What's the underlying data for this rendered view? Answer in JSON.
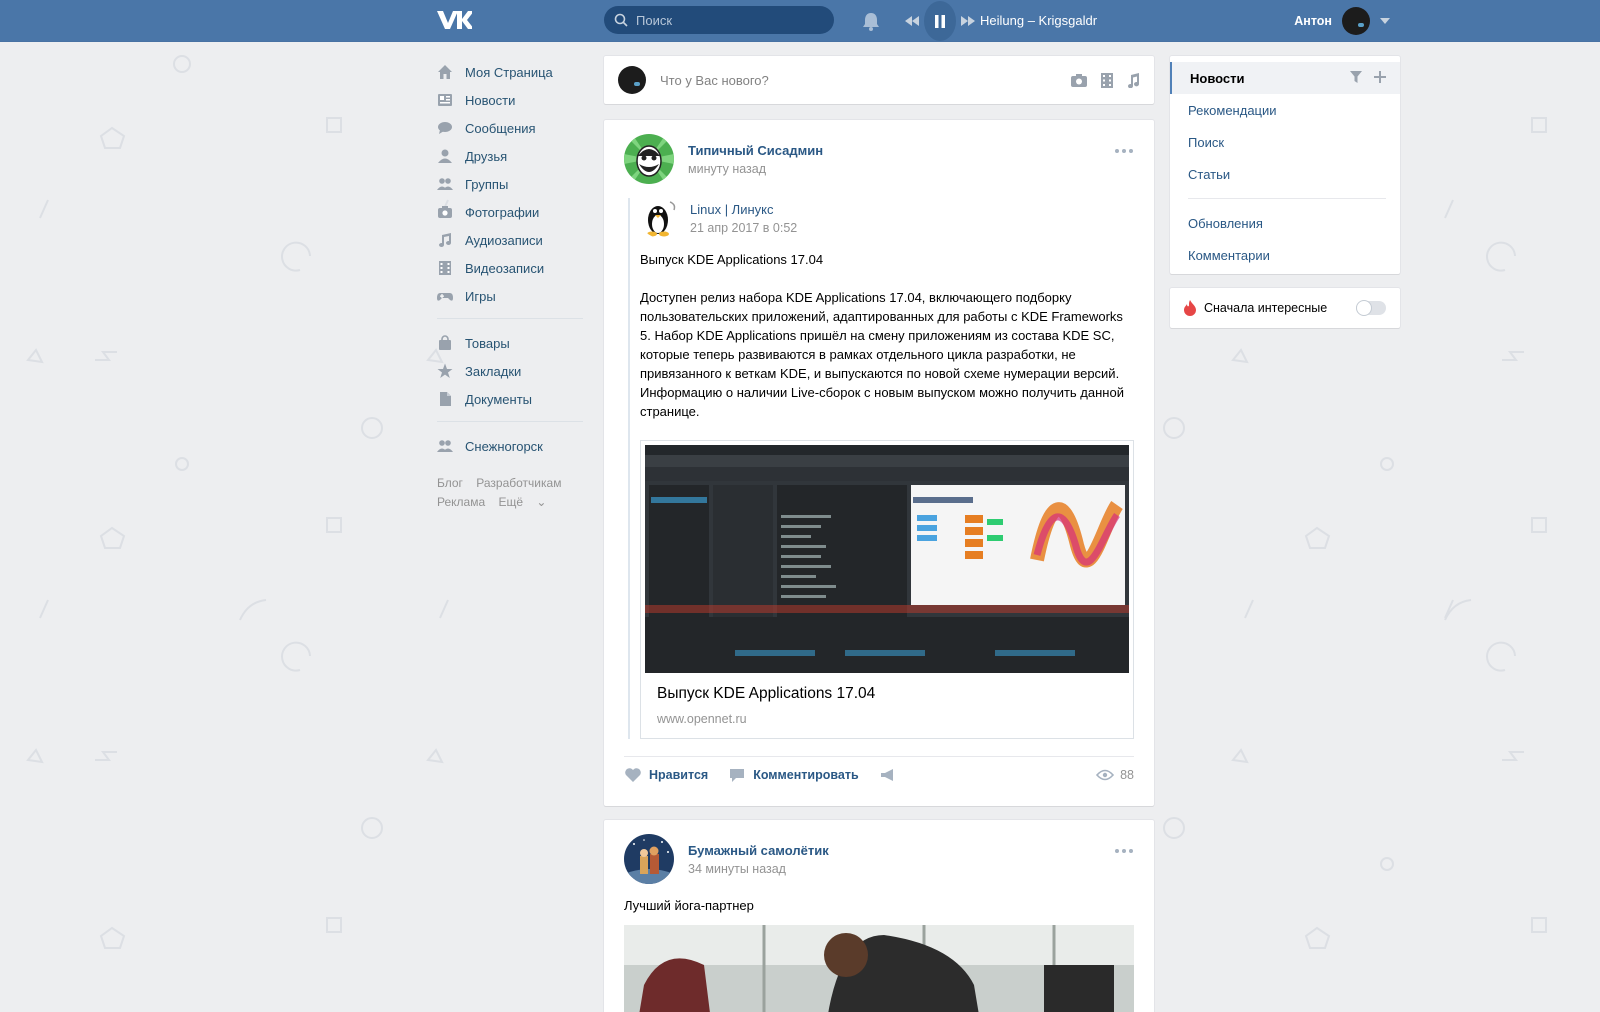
{
  "header": {
    "search_placeholder": "Поиск",
    "track": "Heilung – Krigsgaldr",
    "user_name": "Антон"
  },
  "composer": {
    "placeholder": "Что у Вас нового?"
  },
  "left_nav": {
    "main": [
      {
        "label": "Моя Страница",
        "icon": "home-icon"
      },
      {
        "label": "Новости",
        "icon": "news-icon"
      },
      {
        "label": "Сообщения",
        "icon": "messages-icon"
      },
      {
        "label": "Друзья",
        "icon": "friends-icon"
      },
      {
        "label": "Группы",
        "icon": "groups-icon"
      },
      {
        "label": "Фотографии",
        "icon": "camera-icon"
      },
      {
        "label": "Аудиозаписи",
        "icon": "music-icon"
      },
      {
        "label": "Видеозаписи",
        "icon": "film-icon"
      },
      {
        "label": "Игры",
        "icon": "gamepad-icon"
      }
    ],
    "secondary": [
      {
        "label": "Товары",
        "icon": "bag-icon"
      },
      {
        "label": "Закладки",
        "icon": "star-icon"
      },
      {
        "label": "Документы",
        "icon": "document-icon"
      }
    ],
    "communities": [
      {
        "label": "Снежногорск",
        "icon": "group-icon"
      }
    ],
    "footer": {
      "blog": "Блог",
      "developers": "Разработчикам",
      "ads": "Реклама",
      "more": "Ещё"
    }
  },
  "post1": {
    "author": "Типичный Сисадмин",
    "time": "минуту назад",
    "repost": {
      "author": "Linux | Линукс",
      "time": "21 апр 2017 в 0:52"
    },
    "text_title": "Выпуск KDE Applications 17.04",
    "text_body": "Доступен релиз набора KDE Applications 17.04, включающего подборку пользовательских приложений, адаптированных для работы с KDE Frameworks 5. Набор KDE Applications пришёл на смену приложениям из состава KDE SC, которые теперь развиваются в рамках отдельного цикла разработки, не привязанного к веткам KDE, и выпускаются по новой схеме нумерации версий. Информацию о наличии Live-сборок с новым выпуском можно получить данной странице.",
    "link": {
      "title": "Выпуск KDE Applications 17.04",
      "domain": "www.opennet.ru"
    },
    "actions": {
      "like": "Нравится",
      "comment": "Комментировать",
      "views": "88"
    }
  },
  "post2": {
    "author": "Бумажный самолётик",
    "time": "34 минуты назад",
    "text": "Лучший йога-партнер"
  },
  "right_nav": {
    "items": [
      "Новости",
      "Рекомендации",
      "Поиск",
      "Статьи"
    ],
    "items2": [
      "Обновления",
      "Комментарии"
    ],
    "interesting": "Сначала интересные"
  },
  "colors": {
    "header": "#4a76a8",
    "link": "#2a5885",
    "background": "#edeef0"
  }
}
